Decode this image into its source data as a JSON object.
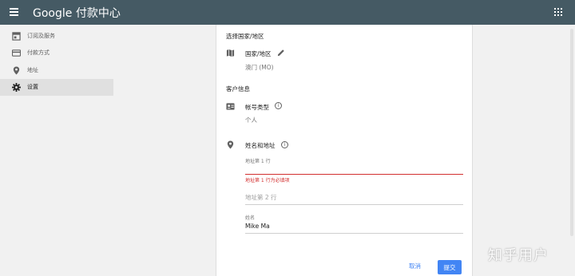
{
  "header": {
    "app_title": "Google 付款中心",
    "menu_icon": "menu-icon",
    "apps_icon": "apps-grid-icon",
    "bar_color": "#455a64"
  },
  "sidebar": {
    "items": [
      {
        "label": "订阅及服务",
        "icon": "subscriptions-icon",
        "active": false
      },
      {
        "label": "付款方式",
        "icon": "credit-card-icon",
        "active": false
      },
      {
        "label": "地址",
        "icon": "location-pin-icon",
        "active": false
      },
      {
        "label": "设置",
        "icon": "gear-icon",
        "active": true
      }
    ]
  },
  "main": {
    "country_section": {
      "title": "选择国家/地区",
      "field_label": "国家/地区",
      "field_value": "澳门 (MO)"
    },
    "customer_section": {
      "title": "客户信息",
      "account_type_label": "帐号类型",
      "account_type_value": "个人",
      "name_address_label": "姓名和地址",
      "address_line1_caption": "地址第 1 行",
      "address_line1_error": "地址第 1 行为必填项",
      "address_line2_placeholder": "地址第 2 行",
      "name_caption": "姓名",
      "name_value": "Mike Ma"
    },
    "actions": {
      "cancel_label": "取消",
      "submit_label": "提交"
    }
  },
  "watermark": "知乎用户",
  "colors": {
    "accent": "#4285f4",
    "error": "#d32f2f"
  }
}
